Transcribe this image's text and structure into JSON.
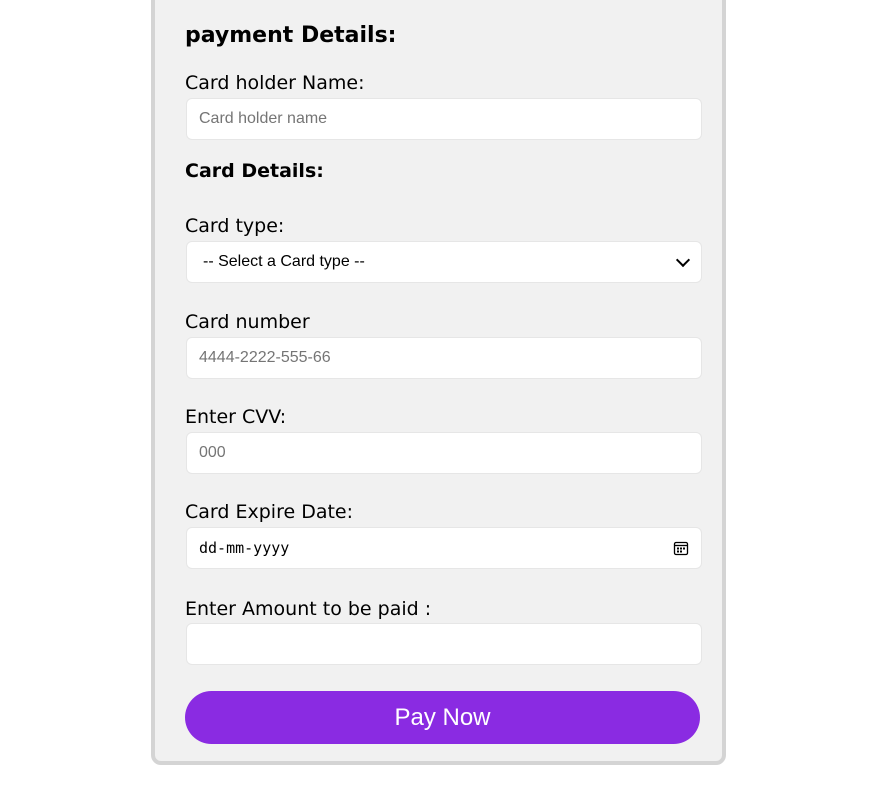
{
  "form": {
    "title": "payment Details:",
    "card_details_heading": "Card Details:",
    "holder_label": "Card holder Name:",
    "holder_placeholder": "Card holder name",
    "type_label": "Card type:",
    "type_selected": "-- Select a Card type --",
    "number_label": "Card number",
    "number_placeholder": "4444-2222-555-66",
    "cvv_label": "Enter CVV:",
    "cvv_placeholder": "000",
    "expiry_label": "Card Expire Date:",
    "expiry_placeholder": "dd-mm-yyyy",
    "amount_label": "Enter Amount to be paid :",
    "amount_value": "",
    "pay_button": "Pay Now"
  },
  "colors": {
    "accent": "#8a2be2",
    "panel_bg": "#f1f1f1",
    "panel_border": "#d4d4d4"
  },
  "icons": {
    "select_arrow": "chevron-down-icon",
    "date_picker": "calendar-icon"
  }
}
